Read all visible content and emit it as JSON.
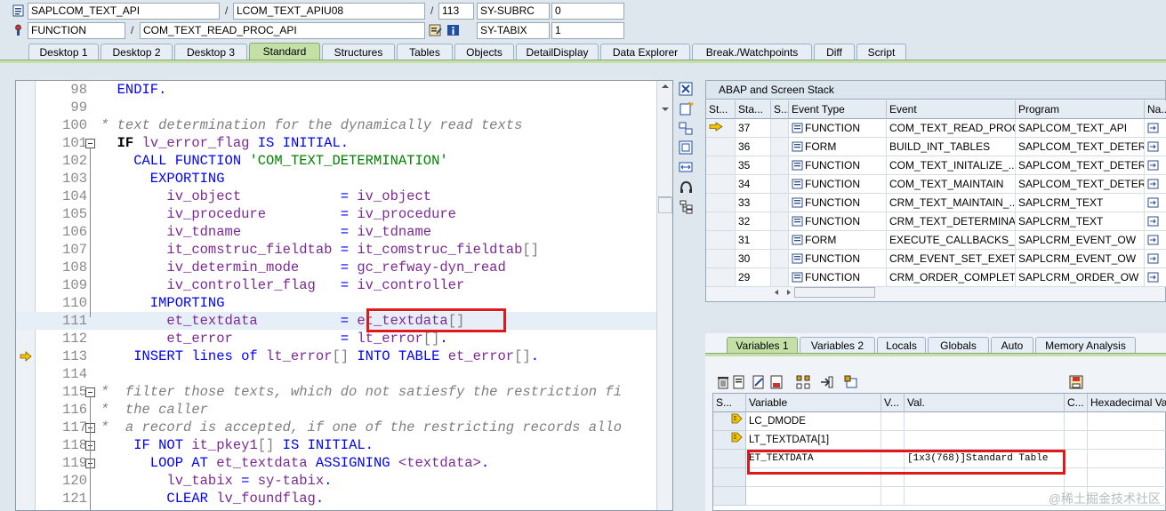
{
  "info": {
    "program": "SAPLCOM_TEXT_API",
    "include": "LCOM_TEXT_APIU08",
    "line": "113",
    "var1_name": "SY-SUBRC",
    "var1_value": "0",
    "event_type": "FUNCTION",
    "event_name": "COM_TEXT_READ_PROC_API",
    "var2_name": "SY-TABIX",
    "var2_value": "1",
    "slash": "/"
  },
  "tabs": [
    "Desktop 1",
    "Desktop 2",
    "Desktop 3",
    "Standard",
    "Structures",
    "Tables",
    "Objects",
    "DetailDisplay",
    "Data Explorer",
    "Break./Watchpoints",
    "Diff",
    "Script"
  ],
  "code_lines": [
    {
      "n": "98",
      "src": [
        [
          "kw",
          "  ENDIF."
        ]
      ],
      "fold": false
    },
    {
      "n": "99",
      "src": [],
      "fold": false
    },
    {
      "n": "100",
      "src": [
        [
          "cm",
          "* text determination for the dynamically read texts"
        ]
      ],
      "fold": false
    },
    {
      "n": "101",
      "src": [
        [
          "kwb",
          "  IF "
        ],
        [
          "id",
          "lv_error_flag"
        ],
        [
          "kw",
          " IS INITIAL."
        ]
      ],
      "fold": true
    },
    {
      "n": "102",
      "src": [
        [
          "kw",
          "    CALL FUNCTION "
        ],
        [
          "str",
          "'COM_TEXT_DETERMINATION'"
        ]
      ],
      "fold": false
    },
    {
      "n": "103",
      "src": [
        [
          "kw",
          "      EXPORTING"
        ]
      ],
      "fold": false
    },
    {
      "n": "104",
      "src": [
        [
          "id",
          "        iv_object            "
        ],
        [
          "kw",
          "= "
        ],
        [
          "id",
          "iv_object"
        ]
      ],
      "fold": false
    },
    {
      "n": "105",
      "src": [
        [
          "id",
          "        iv_procedure         "
        ],
        [
          "kw",
          "= "
        ],
        [
          "id",
          "iv_procedure"
        ]
      ],
      "fold": false
    },
    {
      "n": "106",
      "src": [
        [
          "id",
          "        iv_tdname            "
        ],
        [
          "kw",
          "= "
        ],
        [
          "id",
          "iv_tdname"
        ]
      ],
      "fold": false
    },
    {
      "n": "107",
      "src": [
        [
          "id",
          "        it_comstruc_fieldtab "
        ],
        [
          "kw",
          "= "
        ],
        [
          "id",
          "it_comstruc_fieldtab"
        ],
        [
          "brk",
          "[]"
        ]
      ],
      "fold": false
    },
    {
      "n": "108",
      "src": [
        [
          "id",
          "        iv_determin_mode     "
        ],
        [
          "kw",
          "= "
        ],
        [
          "id",
          "gc_refway-dyn_read"
        ]
      ],
      "fold": false
    },
    {
      "n": "109",
      "src": [
        [
          "id",
          "        iv_controller_flag   "
        ],
        [
          "kw",
          "= "
        ],
        [
          "id",
          "iv_controller"
        ]
      ],
      "fold": false
    },
    {
      "n": "110",
      "src": [
        [
          "kw",
          "      IMPORTING"
        ]
      ],
      "fold": false
    },
    {
      "n": "111",
      "src": [
        [
          "id",
          "        et_textdata          "
        ],
        [
          "kw",
          "= "
        ],
        [
          "id",
          "et_textdata"
        ],
        [
          "brk",
          "[]"
        ]
      ],
      "fold": false
    },
    {
      "n": "112",
      "src": [
        [
          "id",
          "        et_error             "
        ],
        [
          "kw",
          "= "
        ],
        [
          "id",
          "lt_error"
        ],
        [
          "brk",
          "[]"
        ],
        [
          "kw",
          "."
        ]
      ],
      "fold": false
    },
    {
      "n": "113",
      "src": [
        [
          "kw",
          "    INSERT lines of "
        ],
        [
          "id",
          "lt_error"
        ],
        [
          "brk",
          "[]"
        ],
        [
          "kw",
          " INTO TABLE "
        ],
        [
          "id",
          "et_error"
        ],
        [
          "brk",
          "[]"
        ],
        [
          "kw",
          "."
        ]
      ],
      "fold": false
    },
    {
      "n": "114",
      "src": [],
      "fold": false
    },
    {
      "n": "115",
      "src": [
        [
          "cm",
          "*  filter those texts, which do not satiesfy the restriction fi"
        ]
      ],
      "fold": true
    },
    {
      "n": "116",
      "src": [
        [
          "cm",
          "*  the caller"
        ]
      ],
      "fold": false
    },
    {
      "n": "117",
      "src": [
        [
          "cm",
          "*  a record is accepted, if one of the restricting records allo"
        ]
      ],
      "fold": true
    },
    {
      "n": "118",
      "src": [
        [
          "kw",
          "    IF NOT "
        ],
        [
          "id",
          "it_pkey1"
        ],
        [
          "brk",
          "[]"
        ],
        [
          "kw",
          " IS INITIAL."
        ]
      ],
      "fold": true
    },
    {
      "n": "119",
      "src": [
        [
          "kw",
          "      LOOP AT "
        ],
        [
          "id",
          "et_textdata"
        ],
        [
          "kw",
          " ASSIGNING "
        ],
        [
          "id",
          "<textdata>"
        ],
        [
          "kw",
          "."
        ]
      ],
      "fold": true
    },
    {
      "n": "120",
      "src": [
        [
          "id",
          "        lv_tabix"
        ],
        [
          "kw",
          " = "
        ],
        [
          "id",
          "sy-tabix"
        ],
        [
          "kw",
          "."
        ]
      ],
      "fold": false
    },
    {
      "n": "121",
      "src": [
        [
          "kw",
          "        CLEAR "
        ],
        [
          "id",
          "lv_foundflag"
        ],
        [
          "kw",
          "."
        ]
      ],
      "fold": false
    }
  ],
  "stack": {
    "title": "ABAP and Screen Stack",
    "headers": [
      "St...",
      "Sta...",
      "S...",
      "Event Type",
      "Event",
      "Program",
      "Na..."
    ],
    "rows": [
      {
        "level": "37",
        "type": "FUNCTION",
        "event": "COM_TEXT_READ_PROC...",
        "program": "SAPLCOM_TEXT_API",
        "current": true
      },
      {
        "level": "36",
        "type": "FORM",
        "event": "BUILD_INT_TABLES",
        "program": "SAPLCOM_TEXT_DETER...",
        "current": false
      },
      {
        "level": "35",
        "type": "FUNCTION",
        "event": "COM_TEXT_INITALIZE_...",
        "program": "SAPLCOM_TEXT_DETER...",
        "current": false
      },
      {
        "level": "34",
        "type": "FUNCTION",
        "event": "COM_TEXT_MAINTAIN",
        "program": "SAPLCOM_TEXT_DETER...",
        "current": false
      },
      {
        "level": "33",
        "type": "FUNCTION",
        "event": "CRM_TEXT_MAINTAIN_...",
        "program": "SAPLCRM_TEXT",
        "current": false
      },
      {
        "level": "32",
        "type": "FUNCTION",
        "event": "CRM_TEXT_DETERMINA...",
        "program": "SAPLCRM_TEXT",
        "current": false
      },
      {
        "level": "31",
        "type": "FORM",
        "event": "EXECUTE_CALLBACKS_P...",
        "program": "SAPLCRM_EVENT_OW",
        "current": false
      },
      {
        "level": "30",
        "type": "FUNCTION",
        "event": "CRM_EVENT_SET_EXETI...",
        "program": "SAPLCRM_EVENT_OW",
        "current": false
      },
      {
        "level": "29",
        "type": "FUNCTION",
        "event": "CRM_ORDER_COMPLETE...",
        "program": "SAPLCRM_ORDER_OW",
        "current": false
      }
    ]
  },
  "var_tabs": [
    "Variables 1",
    "Variables 2",
    "Locals",
    "Globals",
    "Auto",
    "Memory Analysis"
  ],
  "vars": {
    "headers": [
      "S...",
      "Variable",
      "V...",
      "Val.",
      "C...",
      "Hexadecimal Va"
    ],
    "rows": [
      {
        "name": "LC_DMODE",
        "value": ""
      },
      {
        "name": "LT_TEXTDATA[1]",
        "value": ""
      },
      {
        "name": "ET_TEXTDATA",
        "value": "[1x3(768)]Standard Table"
      }
    ]
  },
  "watermark": "@稀土掘金技术社区",
  "colors": {
    "accent_tab": "#c4e0a7",
    "highlight_box": "#e0181c",
    "keyword": "#0000ff",
    "identifier": "#7b2a93",
    "string": "#008000",
    "comment": "#7f7f7f"
  }
}
